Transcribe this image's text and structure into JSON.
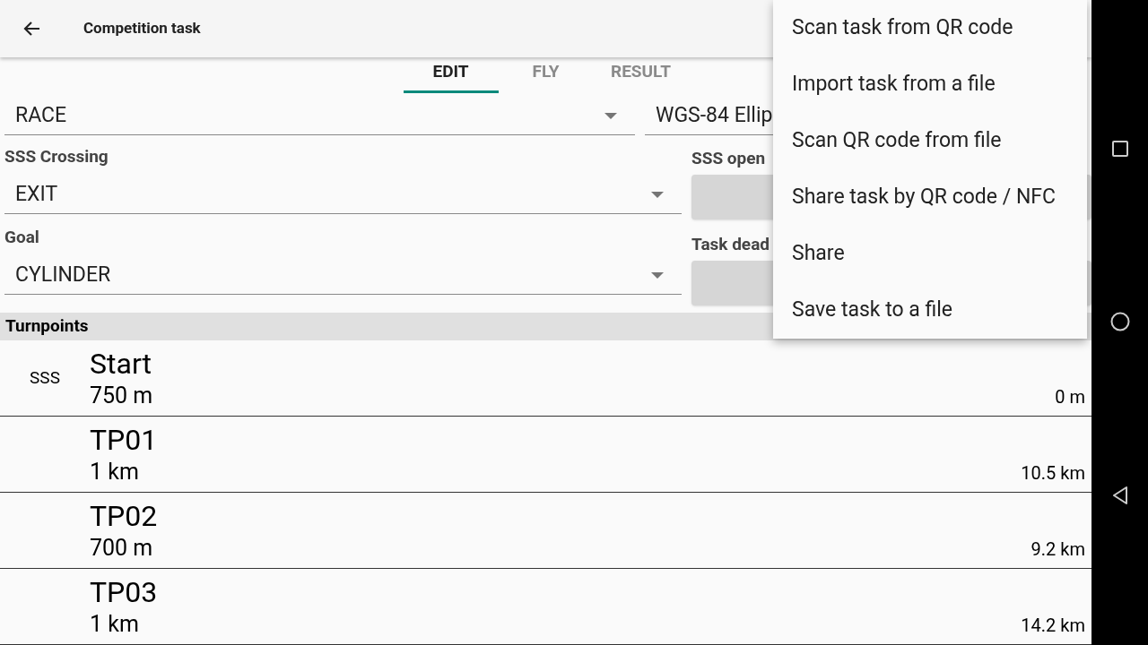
{
  "toolbar": {
    "title": "Competition task"
  },
  "tabs": [
    {
      "label": "EDIT",
      "selected": true
    },
    {
      "label": "FLY",
      "selected": false
    },
    {
      "label": "RESULT",
      "selected": false
    }
  ],
  "task_type": {
    "value": "RACE"
  },
  "earth_model": {
    "value": "WGS-84 Ellip"
  },
  "sss_crossing": {
    "label": "SSS Crossing",
    "value": "EXIT"
  },
  "sss_open": {
    "label": "SSS open"
  },
  "goal": {
    "label": "Goal",
    "value": "CYLINDER"
  },
  "task_deadline": {
    "label": "Task dead"
  },
  "turnpoints": {
    "header": "Turnpoints",
    "items": [
      {
        "tag": "SSS",
        "name": "Start",
        "radius": "750 m",
        "distance": "0 m"
      },
      {
        "name": "TP01",
        "radius": "1 km",
        "distance": "10.5 km"
      },
      {
        "name": "TP02",
        "radius": "700 m",
        "distance": "9.2 km"
      },
      {
        "name": "TP03",
        "radius": "1 km",
        "distance": "14.2 km"
      }
    ]
  },
  "menu": [
    "Scan task from QR code",
    "Import task from a file",
    "Scan QR code from file",
    "Share task by QR code / NFC",
    "Share",
    "Save task to a file"
  ]
}
